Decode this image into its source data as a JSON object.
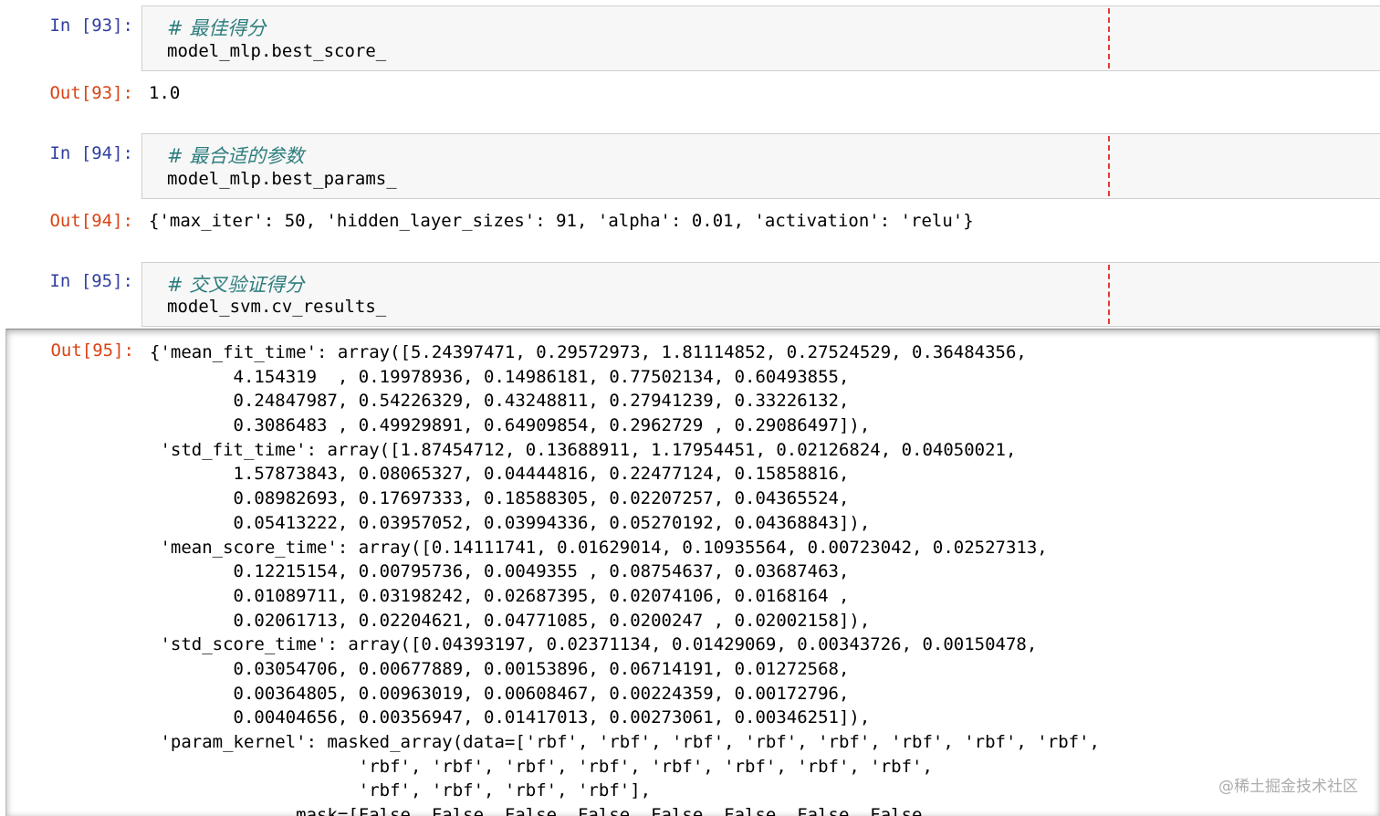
{
  "cells": [
    {
      "in_prompt": "In [93]:",
      "comment": "# 最佳得分",
      "code": "model_mlp.best_score_",
      "out_prompt": "Out[93]:",
      "output": "1.0"
    },
    {
      "in_prompt": "In [94]:",
      "comment": "# 最合适的参数",
      "code": "model_mlp.best_params_",
      "out_prompt": "Out[94]:",
      "output": "{'max_iter': 50, 'hidden_layer_sizes': 91, 'alpha': 0.01, 'activation': 'relu'}"
    },
    {
      "in_prompt": "In [95]:",
      "comment": "# 交叉验证得分",
      "code": "model_svm.cv_results_",
      "out_prompt": "Out[95]:",
      "output_lines": [
        "{'mean_fit_time': array([5.24397471, 0.29572973, 1.81114852, 0.27524529, 0.36484356,",
        "        4.154319  , 0.19978936, 0.14986181, 0.77502134, 0.60493855,",
        "        0.24847987, 0.54226329, 0.43248811, 0.27941239, 0.33226132,",
        "        0.3086483 , 0.49929891, 0.64909854, 0.2962729 , 0.29086497]),",
        " 'std_fit_time': array([1.87454712, 0.13688911, 1.17954451, 0.02126824, 0.04050021,",
        "        1.57873843, 0.08065327, 0.04444816, 0.22477124, 0.15858816,",
        "        0.08982693, 0.17697333, 0.18588305, 0.02207257, 0.04365524,",
        "        0.05413222, 0.03957052, 0.03994336, 0.05270192, 0.04368843]),",
        " 'mean_score_time': array([0.14111741, 0.01629014, 0.10935564, 0.00723042, 0.02527313,",
        "        0.12215154, 0.00795736, 0.0049355 , 0.08754637, 0.03687463,",
        "        0.01089711, 0.03198242, 0.02687395, 0.02074106, 0.0168164 ,",
        "        0.02061713, 0.02204621, 0.04771085, 0.0200247 , 0.02002158]),",
        " 'std_score_time': array([0.04393197, 0.02371134, 0.01429069, 0.00343726, 0.00150478,",
        "        0.03054706, 0.00677889, 0.00153896, 0.06714191, 0.01272568,",
        "        0.00364805, 0.00963019, 0.00608467, 0.00224359, 0.00172796,",
        "        0.00404656, 0.00356947, 0.01417013, 0.00273061, 0.00346251]),",
        " 'param_kernel': masked_array(data=['rbf', 'rbf', 'rbf', 'rbf', 'rbf', 'rbf', 'rbf', 'rbf',",
        "                    'rbf', 'rbf', 'rbf', 'rbf', 'rbf', 'rbf', 'rbf', 'rbf',",
        "                    'rbf', 'rbf', 'rbf', 'rbf'],",
        "              mask=[False, False, False, False, False, False, False, False,"
      ]
    }
  ],
  "watermark": "@稀土掘金技术社区",
  "colors": {
    "in_prompt": "#303f9f",
    "out_prompt": "#d84315",
    "comment": "#2e7d7d",
    "ruler": "#e53935"
  }
}
